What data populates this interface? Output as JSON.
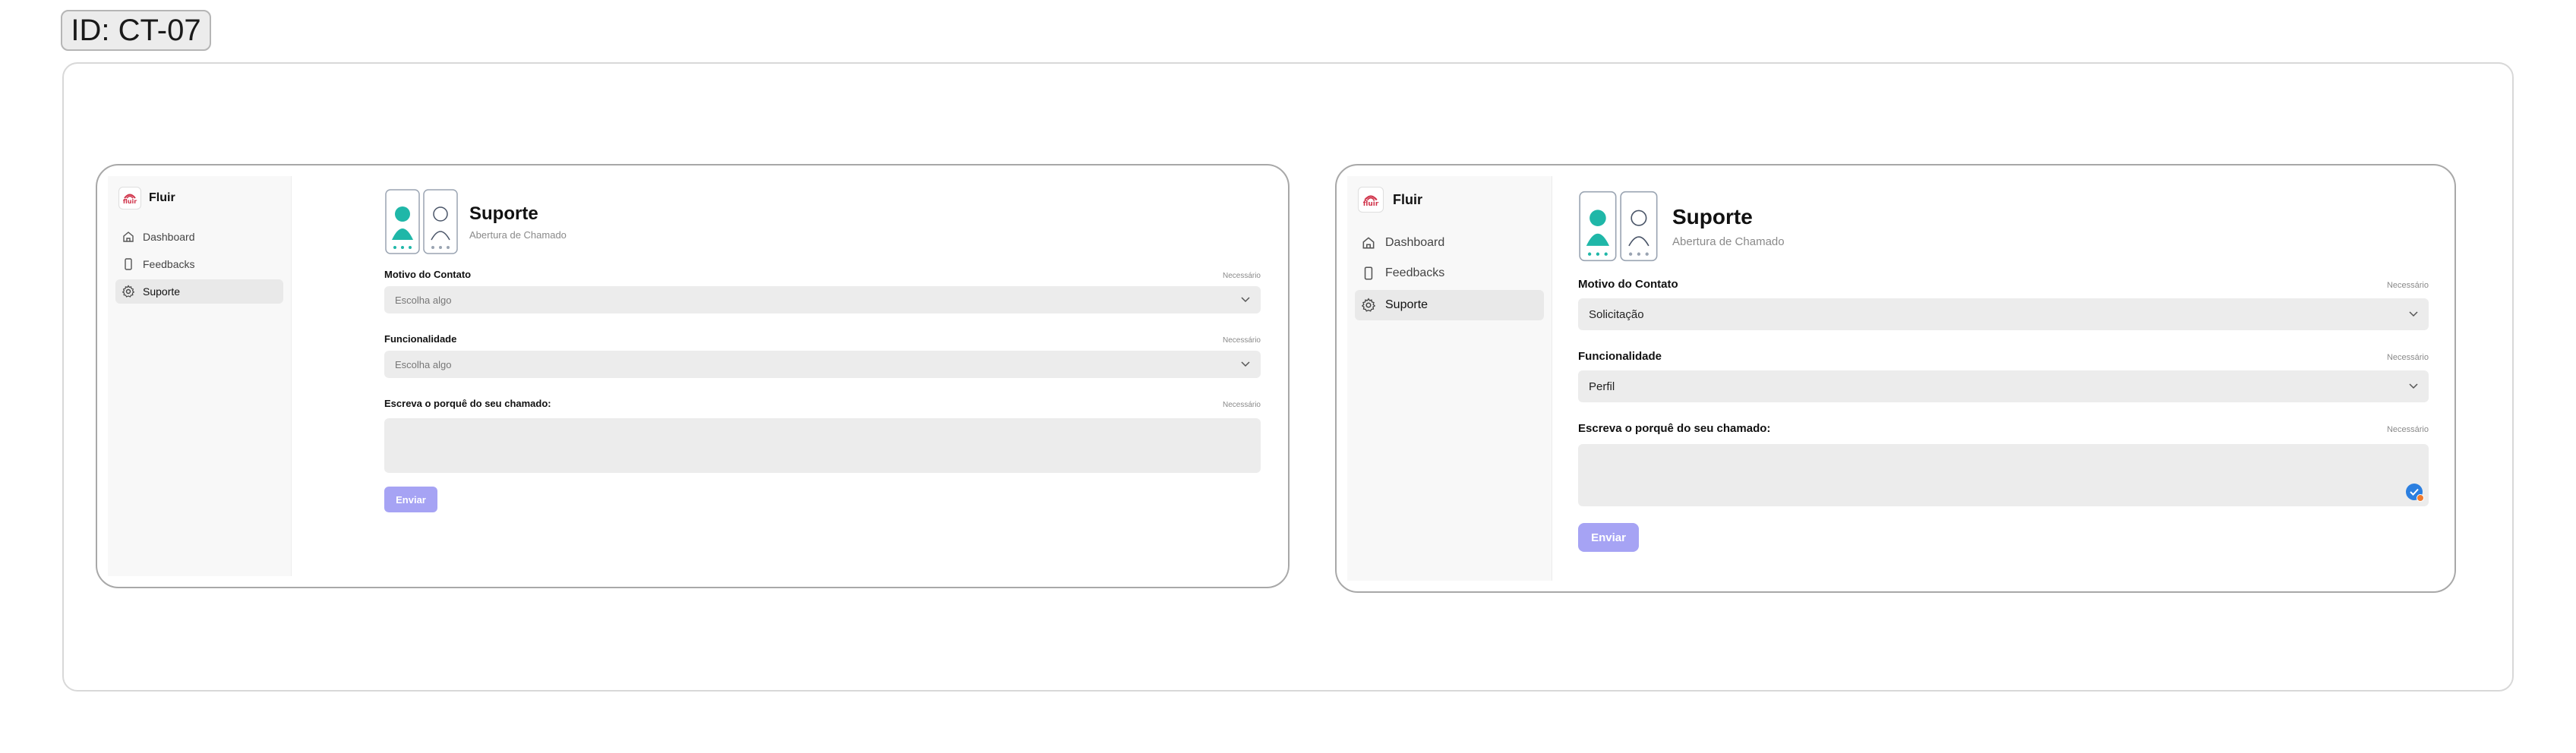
{
  "badge": {
    "text": "ID: CT-07"
  },
  "screens": [
    {
      "brand": "Fluir",
      "logo_text": "fluir",
      "nav": [
        {
          "label": "Dashboard",
          "icon": "home-icon"
        },
        {
          "label": "Feedbacks",
          "icon": "phone-icon"
        },
        {
          "label": "Suporte",
          "icon": "gear-icon",
          "active": true
        }
      ],
      "header": {
        "title": "Suporte",
        "subtitle": "Abertura de Chamado"
      },
      "form": {
        "reason": {
          "label": "Motivo do Contato",
          "required": "Necessário",
          "value": "Escolha algo"
        },
        "feature": {
          "label": "Funcionalidade",
          "required": "Necessário",
          "value": "Escolha algo"
        },
        "description": {
          "label": "Escreva o porquê do seu chamado:",
          "required": "Necessário",
          "value": ""
        },
        "submit": "Enviar"
      }
    },
    {
      "brand": "Fluir",
      "logo_text": "fluir",
      "nav": [
        {
          "label": "Dashboard",
          "icon": "home-icon"
        },
        {
          "label": "Feedbacks",
          "icon": "phone-icon"
        },
        {
          "label": "Suporte",
          "icon": "gear-icon",
          "active": true
        }
      ],
      "header": {
        "title": "Suporte",
        "subtitle": "Abertura de Chamado"
      },
      "form": {
        "reason": {
          "label": "Motivo do Contato",
          "required": "Necessário",
          "value": "Solicitação"
        },
        "feature": {
          "label": "Funcionalidade",
          "required": "Necessário",
          "value": "Perfil"
        },
        "description": {
          "label": "Escreva o porquê do seu chamado:",
          "required": "Necessário",
          "value": ""
        },
        "submit": "Enviar"
      }
    }
  ],
  "colors": {
    "accent": "#a6a3f4",
    "field_bg": "#ececec",
    "sidebar_bg": "#f8f8f8",
    "illustration_teal": "#1fb7a8",
    "logo_red": "#d0334a"
  }
}
